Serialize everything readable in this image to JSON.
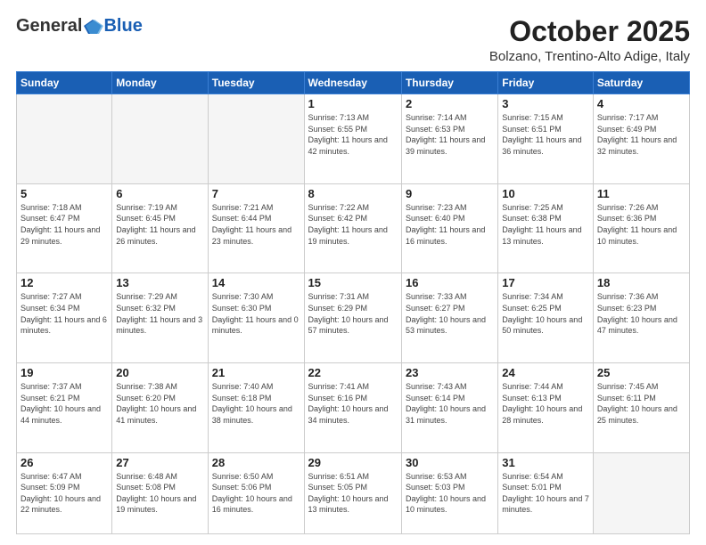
{
  "header": {
    "logo_general": "General",
    "logo_blue": "Blue",
    "month_title": "October 2025",
    "location": "Bolzano, Trentino-Alto Adige, Italy"
  },
  "days_of_week": [
    "Sunday",
    "Monday",
    "Tuesday",
    "Wednesday",
    "Thursday",
    "Friday",
    "Saturday"
  ],
  "weeks": [
    [
      {
        "day": "",
        "info": ""
      },
      {
        "day": "",
        "info": ""
      },
      {
        "day": "",
        "info": ""
      },
      {
        "day": "1",
        "info": "Sunrise: 7:13 AM\nSunset: 6:55 PM\nDaylight: 11 hours and 42 minutes."
      },
      {
        "day": "2",
        "info": "Sunrise: 7:14 AM\nSunset: 6:53 PM\nDaylight: 11 hours and 39 minutes."
      },
      {
        "day": "3",
        "info": "Sunrise: 7:15 AM\nSunset: 6:51 PM\nDaylight: 11 hours and 36 minutes."
      },
      {
        "day": "4",
        "info": "Sunrise: 7:17 AM\nSunset: 6:49 PM\nDaylight: 11 hours and 32 minutes."
      }
    ],
    [
      {
        "day": "5",
        "info": "Sunrise: 7:18 AM\nSunset: 6:47 PM\nDaylight: 11 hours and 29 minutes."
      },
      {
        "day": "6",
        "info": "Sunrise: 7:19 AM\nSunset: 6:45 PM\nDaylight: 11 hours and 26 minutes."
      },
      {
        "day": "7",
        "info": "Sunrise: 7:21 AM\nSunset: 6:44 PM\nDaylight: 11 hours and 23 minutes."
      },
      {
        "day": "8",
        "info": "Sunrise: 7:22 AM\nSunset: 6:42 PM\nDaylight: 11 hours and 19 minutes."
      },
      {
        "day": "9",
        "info": "Sunrise: 7:23 AM\nSunset: 6:40 PM\nDaylight: 11 hours and 16 minutes."
      },
      {
        "day": "10",
        "info": "Sunrise: 7:25 AM\nSunset: 6:38 PM\nDaylight: 11 hours and 13 minutes."
      },
      {
        "day": "11",
        "info": "Sunrise: 7:26 AM\nSunset: 6:36 PM\nDaylight: 11 hours and 10 minutes."
      }
    ],
    [
      {
        "day": "12",
        "info": "Sunrise: 7:27 AM\nSunset: 6:34 PM\nDaylight: 11 hours and 6 minutes."
      },
      {
        "day": "13",
        "info": "Sunrise: 7:29 AM\nSunset: 6:32 PM\nDaylight: 11 hours and 3 minutes."
      },
      {
        "day": "14",
        "info": "Sunrise: 7:30 AM\nSunset: 6:30 PM\nDaylight: 11 hours and 0 minutes."
      },
      {
        "day": "15",
        "info": "Sunrise: 7:31 AM\nSunset: 6:29 PM\nDaylight: 10 hours and 57 minutes."
      },
      {
        "day": "16",
        "info": "Sunrise: 7:33 AM\nSunset: 6:27 PM\nDaylight: 10 hours and 53 minutes."
      },
      {
        "day": "17",
        "info": "Sunrise: 7:34 AM\nSunset: 6:25 PM\nDaylight: 10 hours and 50 minutes."
      },
      {
        "day": "18",
        "info": "Sunrise: 7:36 AM\nSunset: 6:23 PM\nDaylight: 10 hours and 47 minutes."
      }
    ],
    [
      {
        "day": "19",
        "info": "Sunrise: 7:37 AM\nSunset: 6:21 PM\nDaylight: 10 hours and 44 minutes."
      },
      {
        "day": "20",
        "info": "Sunrise: 7:38 AM\nSunset: 6:20 PM\nDaylight: 10 hours and 41 minutes."
      },
      {
        "day": "21",
        "info": "Sunrise: 7:40 AM\nSunset: 6:18 PM\nDaylight: 10 hours and 38 minutes."
      },
      {
        "day": "22",
        "info": "Sunrise: 7:41 AM\nSunset: 6:16 PM\nDaylight: 10 hours and 34 minutes."
      },
      {
        "day": "23",
        "info": "Sunrise: 7:43 AM\nSunset: 6:14 PM\nDaylight: 10 hours and 31 minutes."
      },
      {
        "day": "24",
        "info": "Sunrise: 7:44 AM\nSunset: 6:13 PM\nDaylight: 10 hours and 28 minutes."
      },
      {
        "day": "25",
        "info": "Sunrise: 7:45 AM\nSunset: 6:11 PM\nDaylight: 10 hours and 25 minutes."
      }
    ],
    [
      {
        "day": "26",
        "info": "Sunrise: 6:47 AM\nSunset: 5:09 PM\nDaylight: 10 hours and 22 minutes."
      },
      {
        "day": "27",
        "info": "Sunrise: 6:48 AM\nSunset: 5:08 PM\nDaylight: 10 hours and 19 minutes."
      },
      {
        "day": "28",
        "info": "Sunrise: 6:50 AM\nSunset: 5:06 PM\nDaylight: 10 hours and 16 minutes."
      },
      {
        "day": "29",
        "info": "Sunrise: 6:51 AM\nSunset: 5:05 PM\nDaylight: 10 hours and 13 minutes."
      },
      {
        "day": "30",
        "info": "Sunrise: 6:53 AM\nSunset: 5:03 PM\nDaylight: 10 hours and 10 minutes."
      },
      {
        "day": "31",
        "info": "Sunrise: 6:54 AM\nSunset: 5:01 PM\nDaylight: 10 hours and 7 minutes."
      },
      {
        "day": "",
        "info": ""
      }
    ]
  ]
}
